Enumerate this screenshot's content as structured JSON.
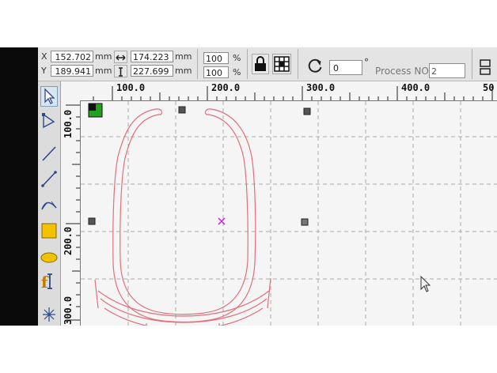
{
  "position": {
    "x_label": "X",
    "x_value": "152.702",
    "x_unit": "mm",
    "y_label": "Y",
    "y_value": "189.941",
    "y_unit": "mm"
  },
  "size": {
    "width_value": "174.223",
    "width_unit": "mm",
    "height_value": "227.699",
    "height_unit": "mm"
  },
  "scale": {
    "x_percent": "100",
    "y_percent": "100",
    "unit": "%"
  },
  "rotation": {
    "value": "0",
    "unit": "°"
  },
  "process": {
    "label": "Process NO:",
    "value": "2"
  },
  "ruler_top_labels": [
    "100.0",
    "200.0",
    "300.0",
    "400.0",
    "50"
  ],
  "ruler_left_labels": [
    "100.0",
    "200.0",
    "300.0"
  ],
  "colors": {
    "shape_outline": "#e0707a",
    "selection_handle": "#555555",
    "corner_handle": "#22a022",
    "center_marker": "#cc22cc",
    "fill_tool": "#f2c200"
  },
  "icons": [
    "select-arrow-icon",
    "node-edit-icon",
    "line-icon",
    "polyline-icon",
    "bezier-icon",
    "rectangle-icon",
    "ellipse-icon",
    "text-icon",
    "lock-icon",
    "grid-icon",
    "rotate-icon",
    "cursor-icon"
  ]
}
